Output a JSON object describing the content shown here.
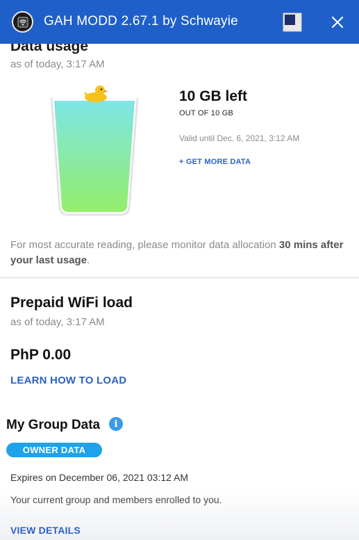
{
  "window": {
    "title": "GAH MODD 2.67.1 by Schwayie",
    "app_icon": "wifi-logo-icon",
    "restore_icon": "restore-icon",
    "close_icon": "close-icon",
    "titlebar_color": "#1f5fc9"
  },
  "data_usage": {
    "title": "Data usage",
    "as_of": "as of today, 3:17 AM",
    "amount_left": "10 GB left",
    "out_of": "OUT OF 10 GB",
    "valid_until": "Valid until Dec. 6, 2021, 3:12 AM",
    "get_more": "+ GET MORE DATA",
    "remaining_fraction": 1.0,
    "glass_gradient_top": "#7ee6e6",
    "glass_gradient_bottom": "#93ee6a",
    "note_prefix": "For most accurate reading, please monitor data allocation ",
    "note_bold": "30 mins after your last usage",
    "note_suffix": "."
  },
  "wifi_load": {
    "title": "Prepaid WiFi load",
    "as_of": "as of today, 3:17 AM",
    "amount": "PhP 0.00",
    "learn_link": "LEARN HOW TO LOAD"
  },
  "group_data": {
    "title": "My Group Data",
    "info_icon": "i",
    "badge": "OWNER DATA",
    "expires": "Expires on December 06, 2021 03:12 AM",
    "description": "Your current group and members enrolled to you.",
    "view_details": "VIEW DETAILS",
    "badge_color": "#1fa2ea"
  },
  "colors": {
    "link": "#2b62c4",
    "secondary_text": "#8a8a8a"
  }
}
